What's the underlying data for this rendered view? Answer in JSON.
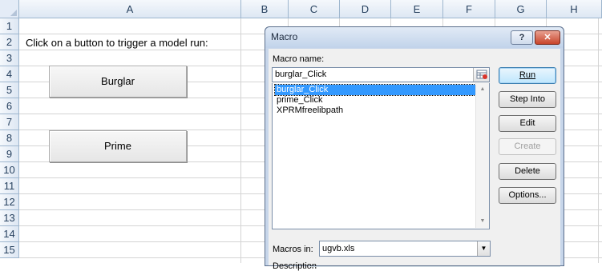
{
  "sheet": {
    "columns": [
      "A",
      "B",
      "C",
      "D",
      "E",
      "F",
      "G",
      "H"
    ],
    "rows": [
      "1",
      "2",
      "3",
      "4",
      "5",
      "6",
      "7",
      "8",
      "9",
      "10",
      "11",
      "12",
      "13",
      "14",
      "15"
    ],
    "instruction": "Click on a button to trigger a model run:",
    "buttons": {
      "burglar": "Burglar",
      "prime": "Prime"
    }
  },
  "dialog": {
    "title": "Macro",
    "help_label": "?",
    "close_label": "✕",
    "macro_name_label": "Macro name:",
    "macro_name_value": "burglar_Click",
    "macros": [
      "burglar_Click",
      "prime_Click",
      "XPRMfreelibpath"
    ],
    "selected_index": 0,
    "buttons": {
      "run": "Run",
      "step_into": "Step Into",
      "edit": "Edit",
      "create": "Create",
      "delete": "Delete",
      "options": "Options..."
    },
    "macros_in_label": "Macros in:",
    "macros_in_value": "ugvb.xls",
    "description_label": "Description"
  },
  "colors": {
    "selection": "#3399ff",
    "dialog_frame": "#c7d6ea",
    "close_button": "#c8442a"
  },
  "icons": [
    "picker-icon",
    "scroll-up-icon",
    "scroll-down-icon",
    "dropdown-arrow-icon"
  ]
}
